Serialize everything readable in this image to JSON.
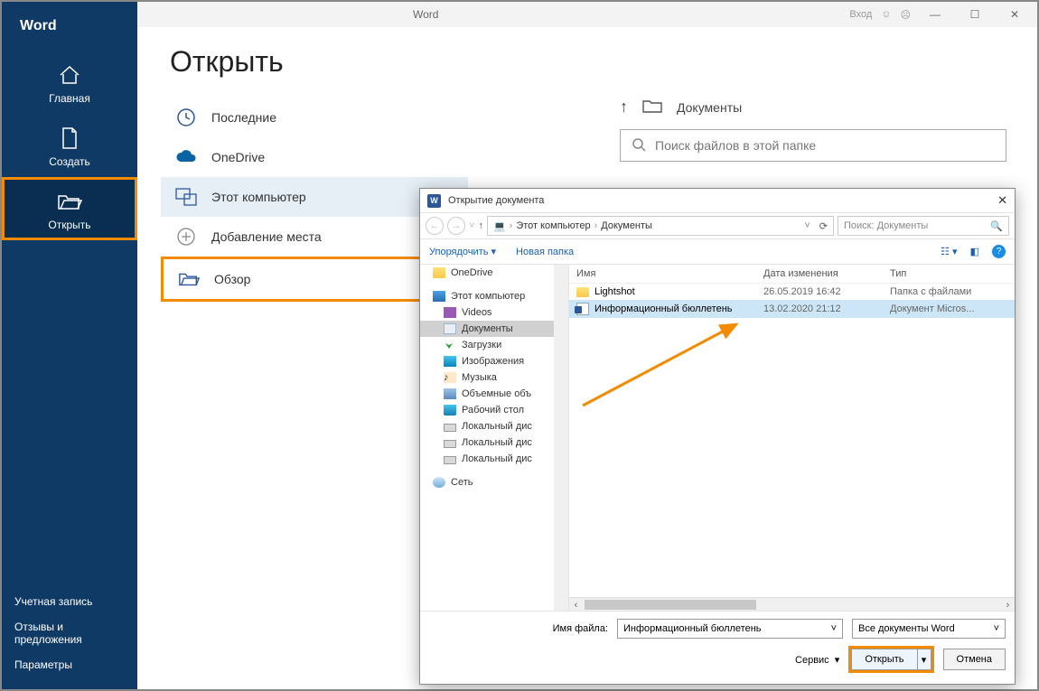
{
  "titlebar": {
    "app_title": "Word",
    "login": "Вход"
  },
  "nav": {
    "brand": "Word",
    "items": [
      {
        "id": "home",
        "label": "Главная"
      },
      {
        "id": "new",
        "label": "Создать"
      },
      {
        "id": "open",
        "label": "Открыть"
      }
    ],
    "bottom": [
      {
        "id": "account",
        "label": "Учетная запись"
      },
      {
        "id": "feedback",
        "label": "Отзывы и предложения"
      },
      {
        "id": "options",
        "label": "Параметры"
      }
    ]
  },
  "page": {
    "title": "Открыть"
  },
  "sources": [
    {
      "id": "recent",
      "label": "Последние"
    },
    {
      "id": "onedrive",
      "label": "OneDrive"
    },
    {
      "id": "thispc",
      "label": "Этот компьютер",
      "active": true
    },
    {
      "id": "addplace",
      "label": "Добавление места"
    },
    {
      "id": "browse",
      "label": "Обзор",
      "highlight": true
    }
  ],
  "breadcrumb": {
    "label": "Документы"
  },
  "search": {
    "placeholder": "Поиск файлов в этой папке"
  },
  "dialog": {
    "title": "Открытие документа",
    "path": {
      "root": "Этот компьютер",
      "folder": "Документы"
    },
    "search_placeholder": "Поиск: Документы",
    "organize": "Упорядочить",
    "newfolder": "Новая папка",
    "tree": [
      {
        "label": "OneDrive",
        "icon": "cloud",
        "level": 0
      },
      {
        "label": "Этот компьютер",
        "icon": "pc",
        "level": 0
      },
      {
        "label": "Videos",
        "icon": "vid",
        "level": 1
      },
      {
        "label": "Документы",
        "icon": "doc",
        "level": 1,
        "selected": true
      },
      {
        "label": "Загрузки",
        "icon": "down",
        "level": 1
      },
      {
        "label": "Изображения",
        "icon": "img",
        "level": 1
      },
      {
        "label": "Музыка",
        "icon": "mus",
        "level": 1
      },
      {
        "label": "Объемные объ",
        "icon": "vol",
        "level": 1
      },
      {
        "label": "Рабочий стол",
        "icon": "desk",
        "level": 1
      },
      {
        "label": "Локальный дис",
        "icon": "disk",
        "level": 1
      },
      {
        "label": "Локальный дис",
        "icon": "disk",
        "level": 1
      },
      {
        "label": "Локальный дис",
        "icon": "disk",
        "level": 1
      },
      {
        "label": "Сеть",
        "icon": "net",
        "level": 0
      }
    ],
    "columns": {
      "name": "Имя",
      "modified": "Дата изменения",
      "type": "Тип"
    },
    "rows": [
      {
        "name": "Lightshot",
        "kind": "folder",
        "modified": "26.05.2019 16:42",
        "type": "Папка с файлами"
      },
      {
        "name": "Информационный бюллетень",
        "kind": "docx",
        "modified": "13.02.2020 21:12",
        "type": "Документ Micros...",
        "selected": true
      }
    ],
    "footer": {
      "filename_label": "Имя файла:",
      "filename_value": "Информационный бюллетень",
      "filter": "Все документы Word",
      "service": "Сервис",
      "open": "Открыть",
      "cancel": "Отмена"
    }
  }
}
